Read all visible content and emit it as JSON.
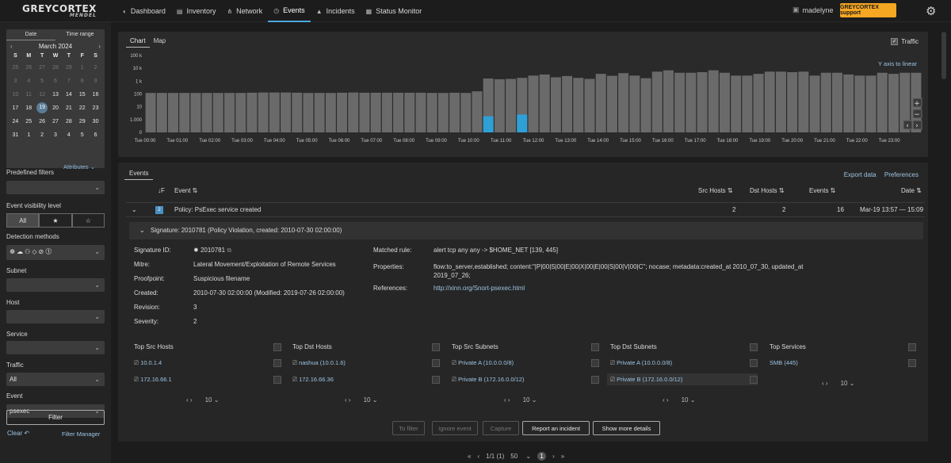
{
  "topbar": {
    "logo": "GREYCORTEX",
    "logo_sub": "MENDEL",
    "nav": [
      {
        "label": "Dashboard",
        "icon": "dashboard-icon",
        "glyph": "◐",
        "active": false
      },
      {
        "label": "Inventory",
        "icon": "inventory-icon",
        "glyph": "▤",
        "active": false
      },
      {
        "label": "Network",
        "icon": "network-icon",
        "glyph": "⋔",
        "active": false
      },
      {
        "label": "Events",
        "icon": "events-icon",
        "glyph": "◷",
        "active": true
      },
      {
        "label": "Incidents",
        "icon": "incidents-icon",
        "glyph": "▲",
        "active": false
      },
      {
        "label": "Status Monitor",
        "icon": "status-monitor-icon",
        "glyph": "▦",
        "active": false
      }
    ],
    "user": "madelyne",
    "support": "GREYCORTEX support"
  },
  "sidebar": {
    "cal_tabs": [
      "Date",
      "Time range"
    ],
    "month": "March 2024",
    "dow": [
      "S",
      "M",
      "T",
      "W",
      "T",
      "F",
      "S"
    ],
    "days": [
      {
        "d": "25",
        "dim": true
      },
      {
        "d": "26",
        "dim": true
      },
      {
        "d": "27",
        "dim": true
      },
      {
        "d": "28",
        "dim": true
      },
      {
        "d": "29",
        "dim": true
      },
      {
        "d": "1",
        "dim": true
      },
      {
        "d": "2",
        "dim": true
      },
      {
        "d": "3",
        "dim": true
      },
      {
        "d": "4",
        "dim": true
      },
      {
        "d": "5",
        "dim": true
      },
      {
        "d": "6",
        "dim": true
      },
      {
        "d": "7",
        "dim": true
      },
      {
        "d": "8",
        "dim": true
      },
      {
        "d": "9",
        "dim": true
      },
      {
        "d": "10",
        "dim": true
      },
      {
        "d": "11",
        "dim": true
      },
      {
        "d": "12",
        "dim": true
      },
      {
        "d": "13",
        "dim": false
      },
      {
        "d": "14",
        "dim": false
      },
      {
        "d": "15",
        "dim": false
      },
      {
        "d": "16",
        "dim": false
      },
      {
        "d": "17",
        "dim": false
      },
      {
        "d": "18",
        "dim": false
      },
      {
        "d": "19",
        "dim": false,
        "sel": true
      },
      {
        "d": "20",
        "dim": false
      },
      {
        "d": "21",
        "dim": false
      },
      {
        "d": "22",
        "dim": false
      },
      {
        "d": "23",
        "dim": false
      },
      {
        "d": "24",
        "dim": false
      },
      {
        "d": "25",
        "dim": false
      },
      {
        "d": "26",
        "dim": false
      },
      {
        "d": "27",
        "dim": false
      },
      {
        "d": "28",
        "dim": false
      },
      {
        "d": "29",
        "dim": false
      },
      {
        "d": "30",
        "dim": false
      },
      {
        "d": "31",
        "dim": false
      },
      {
        "d": "1",
        "dim": false
      },
      {
        "d": "2",
        "dim": false
      },
      {
        "d": "3",
        "dim": false
      },
      {
        "d": "4",
        "dim": false
      },
      {
        "d": "5",
        "dim": false
      },
      {
        "d": "6",
        "dim": false
      }
    ],
    "attributes": "Attributes",
    "predefined_filters": "Predefined filters",
    "event_visibility": "Event visibility level",
    "vis_all": "All",
    "detection_methods": "Detection methods",
    "detection_icons": "☸☁⚇◇⊘⓵",
    "subnet": "Subnet",
    "host": "Host",
    "service": "Service",
    "traffic": "Traffic",
    "traffic_value": "All",
    "event": "Event",
    "event_value": "psexec",
    "filter": "Filter",
    "clear": "Clear",
    "filter_manager": "Filter Manager"
  },
  "chart_panel": {
    "tabs": [
      "Chart",
      "Map"
    ],
    "traffic_label": "Traffic",
    "y_axis_link": "Y axis to linear"
  },
  "chart_data": {
    "type": "bar",
    "scale": "log",
    "yticks": [
      "100 k",
      "10 k",
      "1 k",
      "100",
      "10",
      "1.000",
      "0"
    ],
    "xticks": [
      "Tue 00:00",
      "Tue 01:00",
      "Tue 02:00",
      "Tue 03:00",
      "Tue 04:00",
      "Tue 05:00",
      "Tue 06:00",
      "Tue 07:00",
      "Tue 08:00",
      "Tue 09:00",
      "Tue 10:00",
      "Tue 11:00",
      "Tue 12:00",
      "Tue 13:00",
      "Tue 14:00",
      "Tue 15:00",
      "Tue 16:00",
      "Tue 17:00",
      "Tue 18:00",
      "Tue 19:00",
      "Tue 20:00",
      "Tue 21:00",
      "Tue 22:00",
      "Tue 23:00"
    ],
    "series": [
      {
        "name": "Traffic",
        "color": "#6a6a6a",
        "values": [
          120,
          120,
          120,
          120,
          120,
          120,
          120,
          120,
          120,
          125,
          130,
          130,
          130,
          125,
          120,
          120,
          120,
          125,
          130,
          125,
          125,
          125,
          125,
          125,
          125,
          120,
          120,
          125,
          120,
          160,
          1600,
          1400,
          1500,
          1800,
          2700,
          3300,
          2000,
          2500,
          1800,
          1500,
          3700,
          2600,
          4200,
          2700,
          1700,
          5500,
          7000,
          4500,
          4500,
          5000,
          7000,
          4500,
          2700,
          2700,
          3700,
          5500,
          5500,
          5000,
          5500,
          2700,
          4500,
          4500,
          3300,
          2700,
          2700,
          4500,
          3700,
          4500,
          4500
        ]
      },
      {
        "name": "Events",
        "color": "#2fa0d6",
        "values": [
          0,
          0,
          0,
          0,
          0,
          0,
          0,
          0,
          0,
          0,
          0,
          0,
          0,
          0,
          0,
          0,
          0,
          0,
          0,
          0,
          0,
          0,
          0,
          0,
          0,
          0,
          0,
          0,
          0,
          0,
          1.8,
          0,
          0,
          2.5,
          0,
          0,
          0,
          0,
          0,
          0,
          0,
          0,
          0,
          0,
          0,
          0,
          0,
          0,
          0,
          0,
          0,
          0,
          0,
          0,
          0,
          0,
          0,
          0,
          0,
          0,
          0,
          0,
          0,
          0,
          0,
          0,
          0,
          0,
          0
        ]
      }
    ]
  },
  "events": {
    "tab": "Events",
    "export": "Export data",
    "preferences": "Preferences",
    "columns": {
      "sort": "↓F",
      "event": "Event ⇅",
      "src": "Src Hosts ⇅",
      "dst": "Dst Hosts ⇅",
      "events": "Events ⇅",
      "date": "Date ⇅"
    },
    "row": {
      "badge": "2",
      "name": "Policy: PsExec service created",
      "src": "2",
      "dst": "2",
      "events": "16",
      "date": "Mar-19 13:57 — 15:09"
    },
    "signature_bar": "Signature: 2010781 (Policy Violation, created: 2010-07-30 02:00:00)",
    "details": {
      "sig_id_label": "Signature ID:",
      "sig_id": "2010781",
      "mitre_label": "Mitre:",
      "mitre": "Lateral Movement/Exploitation of Remote Services",
      "proof_label": "Proofpoint:",
      "proof": "Suspicious filename",
      "created_label": "Created:",
      "created": "2010-07-30 02:00:00 (Modified: 2019-07-26 02:00:00)",
      "revision_label": "Revision:",
      "revision": "3",
      "severity_label": "Severity:",
      "severity": "2",
      "matched_label": "Matched rule:",
      "matched": "alert tcp any any -> $HOME_NET [139, 445]",
      "props_label": "Properties:",
      "props_1": "flow:to_server,established; content:\"|P|00|S|00|E|00|X|00|E|00|S|00|V|00|C\"; nocase; metadata:created_at 2010_07_30, updated_at",
      "props_2": "2019_07_26;",
      "refs_label": "References:",
      "refs": "http://xinn.org/Snort-psexec.html"
    },
    "tops": [
      {
        "title": "Top Src Hosts",
        "items": [
          "10.0.1.4",
          "172.16.66.1"
        ]
      },
      {
        "title": "Top Dst Hosts",
        "items": [
          "nashua (10.0.1.6)",
          "172.16.66.36"
        ]
      },
      {
        "title": "Top Src Subnets",
        "items": [
          "Private A (10.0.0.0/8)",
          "Private B (172.16.0.0/12)"
        ]
      },
      {
        "title": "Top Dst Subnets",
        "items": [
          "Private A (10.0.0.0/8)",
          "Private B (172.16.0.0/12)"
        ]
      },
      {
        "title": "Top Services",
        "items": [
          "SMB (445)"
        ]
      }
    ],
    "page_size": "10",
    "buttons": {
      "to_filter": "To filter",
      "ignore": "Ignore event",
      "capture": "Capture",
      "report": "Report an incident",
      "more": "Show more details"
    }
  },
  "pager": {
    "info": "1/1 (1)",
    "size": "50",
    "page": "1"
  }
}
